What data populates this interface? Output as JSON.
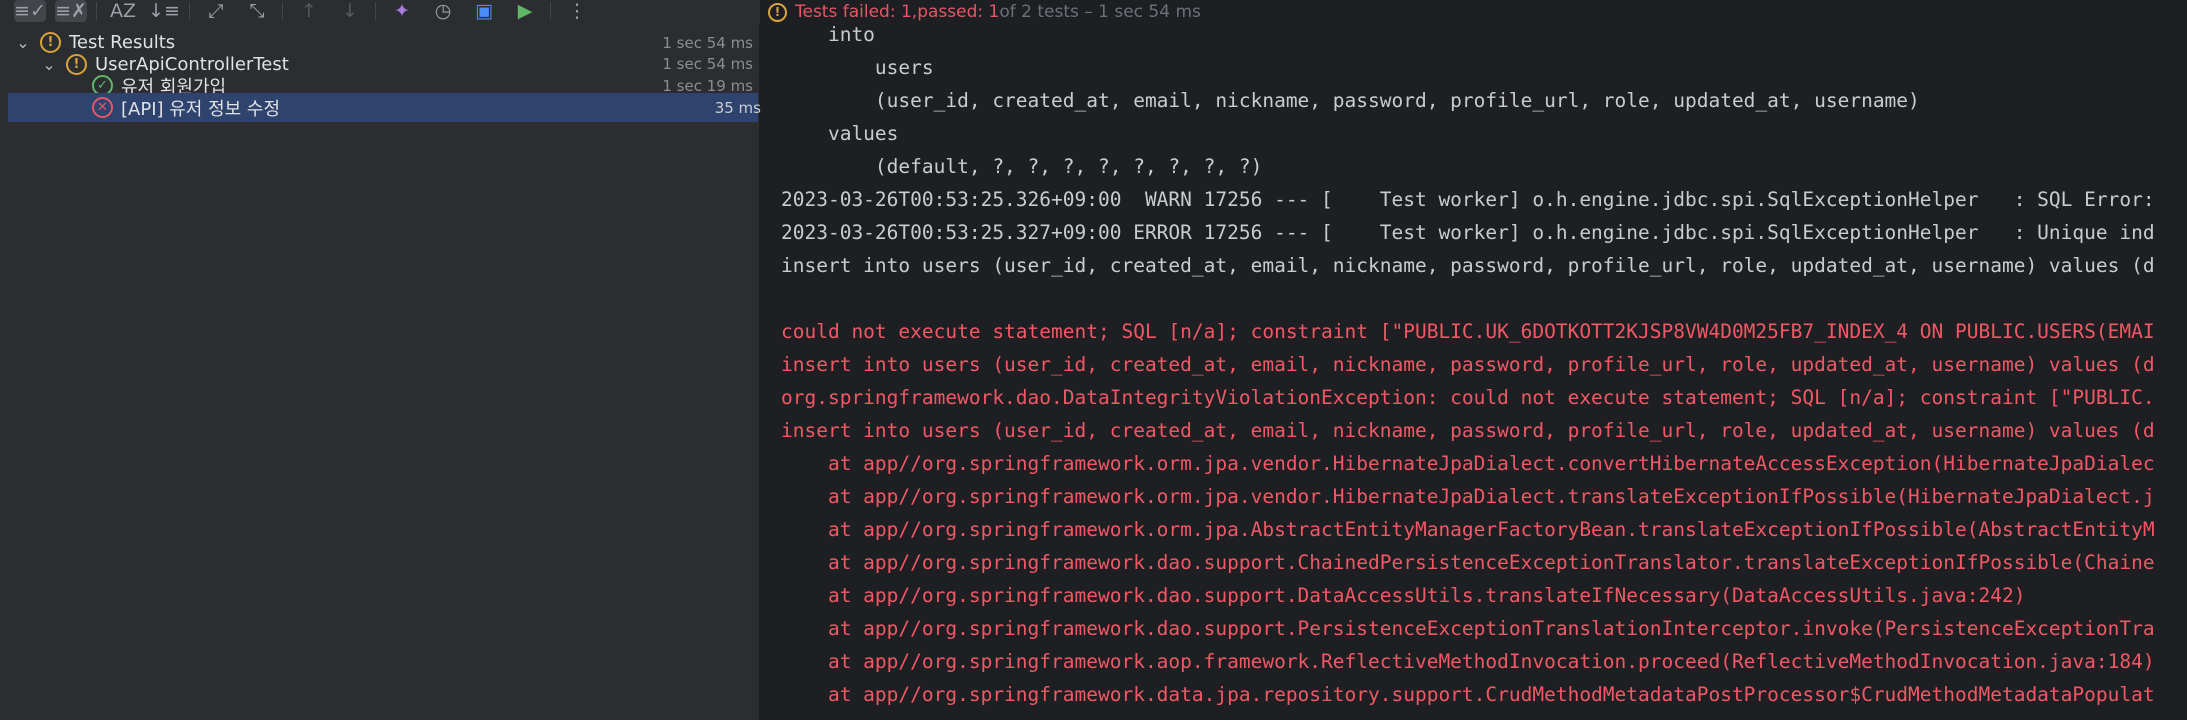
{
  "toolbar": {
    "buttons": [
      {
        "name": "show-passed-icon",
        "glyph": "≡✓",
        "state": "active"
      },
      {
        "name": "show-ignored-icon",
        "glyph": "≡✗",
        "state": "active"
      },
      {
        "name": "sort-alphabetically-icon",
        "glyph": "AZ",
        "state": "normal"
      },
      {
        "name": "sort-by-duration-icon",
        "glyph": "↓≡",
        "state": "normal"
      },
      {
        "name": "expand-all-icon",
        "glyph": "⤢",
        "state": "normal"
      },
      {
        "name": "collapse-all-icon",
        "glyph": "⤡",
        "state": "normal"
      },
      {
        "name": "previous-failed-icon",
        "glyph": "↑",
        "state": "disabled"
      },
      {
        "name": "next-failed-icon",
        "glyph": "↓",
        "state": "disabled"
      },
      {
        "name": "pin-icon",
        "glyph": "✦",
        "state": "purple"
      },
      {
        "name": "history-icon",
        "glyph": "◷",
        "state": "normal"
      },
      {
        "name": "import-tests-icon",
        "glyph": "▣",
        "state": "blue"
      },
      {
        "name": "export-tests-icon",
        "glyph": "▶",
        "state": "green"
      },
      {
        "name": "more-options-icon",
        "glyph": "⋮",
        "state": "normal"
      }
    ]
  },
  "status": {
    "failed_text": "Tests failed: 1",
    "sep": ", ",
    "passed_text": "passed: 1",
    "rest": " of 2 tests – 1 sec 54 ms"
  },
  "tree": [
    {
      "name": "tree-item-test-results",
      "indent": 0,
      "chevron": "⌄",
      "status": "warn",
      "label": "Test Results",
      "time": "1 sec 54 ms",
      "selected": false
    },
    {
      "name": "tree-item-user-api-controller-test",
      "indent": 1,
      "chevron": "⌄",
      "status": "warn",
      "label": "UserApiControllerTest",
      "time": "1 sec 54 ms",
      "selected": false
    },
    {
      "name": "tree-item-user-signup",
      "indent": 2,
      "chevron": "",
      "status": "pass",
      "label": "유저 회원가입",
      "time": "1 sec 19 ms",
      "selected": false
    },
    {
      "name": "tree-item-user-info-update",
      "indent": 2,
      "chevron": "",
      "status": "fail",
      "label": "[API] 유저 정보 수정",
      "time": "35 ms",
      "selected": true
    }
  ],
  "console": [
    {
      "text": "    into",
      "type": "normal"
    },
    {
      "text": "        users",
      "type": "normal"
    },
    {
      "text": "        (user_id, created_at, email, nickname, password, profile_url, role, updated_at, username)",
      "type": "normal"
    },
    {
      "text": "    values",
      "type": "normal"
    },
    {
      "text": "        (default, ?, ?, ?, ?, ?, ?, ?, ?)",
      "type": "normal"
    },
    {
      "text": "2023-03-26T00:53:25.326+09:00  WARN 17256 --- [    Test worker] o.h.engine.jdbc.spi.SqlExceptionHelper   : SQL Error:",
      "type": "normal"
    },
    {
      "text": "2023-03-26T00:53:25.327+09:00 ERROR 17256 --- [    Test worker] o.h.engine.jdbc.spi.SqlExceptionHelper   : Unique ind",
      "type": "normal"
    },
    {
      "text": "insert into users (user_id, created_at, email, nickname, password, profile_url, role, updated_at, username) values (d",
      "type": "normal"
    },
    {
      "text": "",
      "type": "normal"
    },
    {
      "text": "could not execute statement; SQL [n/a]; constraint [\"PUBLIC.UK_6DOTKOTT2KJSP8VW4D0M25FB7_INDEX_4 ON PUBLIC.USERS(EMAI",
      "type": "error"
    },
    {
      "text": "insert into users (user_id, created_at, email, nickname, password, profile_url, role, updated_at, username) values (d",
      "type": "error"
    },
    {
      "text": "org.springframework.dao.DataIntegrityViolationException: could not execute statement; SQL [n/a]; constraint [\"PUBLIC.",
      "type": "error"
    },
    {
      "text": "insert into users (user_id, created_at, email, nickname, password, profile_url, role, updated_at, username) values (d",
      "type": "error"
    },
    {
      "text": "    at app//org.springframework.orm.jpa.vendor.HibernateJpaDialect.convertHibernateAccessException(HibernateJpaDialec",
      "type": "error"
    },
    {
      "text": "    at app//org.springframework.orm.jpa.vendor.HibernateJpaDialect.translateExceptionIfPossible(HibernateJpaDialect.j",
      "type": "error"
    },
    {
      "text": "    at app//org.springframework.orm.jpa.AbstractEntityManagerFactoryBean.translateExceptionIfPossible(AbstractEntityM",
      "type": "error"
    },
    {
      "text": "    at app//org.springframework.dao.support.ChainedPersistenceExceptionTranslator.translateExceptionIfPossible(Chaine",
      "type": "error"
    },
    {
      "text": "    at app//org.springframework.dao.support.DataAccessUtils.translateIfNecessary(DataAccessUtils.java:242)",
      "type": "error"
    },
    {
      "text": "    at app//org.springframework.dao.support.PersistenceExceptionTranslationInterceptor.invoke(PersistenceExceptionTra",
      "type": "error"
    },
    {
      "text": "    at app//org.springframework.aop.framework.ReflectiveMethodInvocation.proceed(ReflectiveMethodInvocation.java:184)",
      "type": "error"
    },
    {
      "text": "    at app//org.springframework.data.jpa.repository.support.CrudMethodMetadataPostProcessor$CrudMethodMetadataPopulat",
      "type": "error"
    }
  ]
}
